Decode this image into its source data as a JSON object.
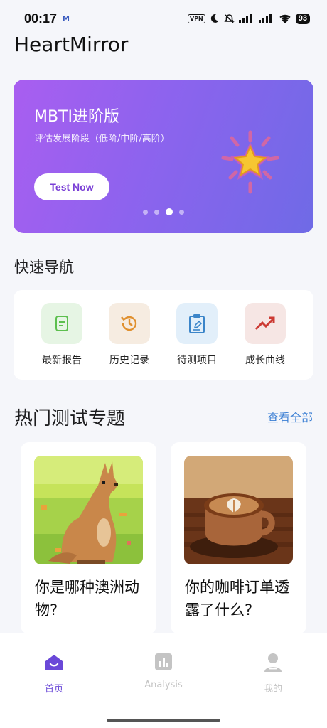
{
  "status": {
    "time": "00:17",
    "carrier_icon": "M",
    "vpn": "VPN",
    "battery": "93"
  },
  "app": {
    "title": "HeartMirror"
  },
  "banner": {
    "title": "MBTI进阶版",
    "subtitle": "评估发展阶段（低阶/中阶/高阶）",
    "button": "Test Now",
    "active_slide": 3,
    "slide_count": 4,
    "gradient": [
      "#a95ef0",
      "#6f6ae6"
    ]
  },
  "quick_nav": {
    "title": "快速导航",
    "items": [
      {
        "label": "最新报告",
        "icon": "report-icon",
        "bg": "#e6f5e4",
        "color": "#5cbf4e"
      },
      {
        "label": "历史记录",
        "icon": "history-icon",
        "bg": "#f6ece1",
        "color": "#e0902f"
      },
      {
        "label": "待测项目",
        "icon": "clipboard-icon",
        "bg": "#e2effa",
        "color": "#3b85c9"
      },
      {
        "label": "成长曲线",
        "icon": "trend-icon",
        "bg": "#f6e6e4",
        "color": "#cc3a33"
      }
    ]
  },
  "hot": {
    "title": "热门测试专题",
    "view_all": "查看全部",
    "topics": [
      {
        "title": "你是哪种澳洲动物?",
        "image": "kangaroo-image"
      },
      {
        "title": "你的咖啡订单透露了什么?",
        "image": "latte-image"
      }
    ]
  },
  "tabbar": {
    "tabs": [
      {
        "label": "首页",
        "icon": "home-icon",
        "active": true
      },
      {
        "label": "Analysis",
        "icon": "analysis-icon",
        "active": false
      },
      {
        "label": "我的",
        "icon": "profile-icon",
        "active": false
      }
    ],
    "active_color": "#6a48d8",
    "inactive_color": "#c4c4c4"
  }
}
